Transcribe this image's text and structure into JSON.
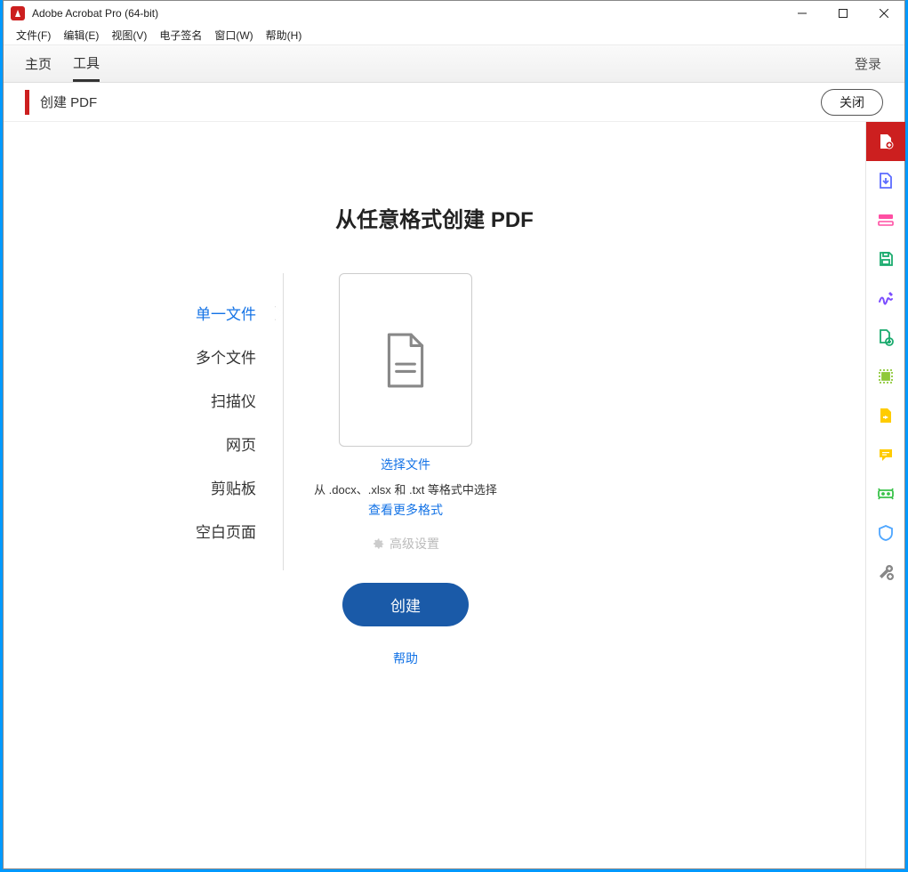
{
  "titlebar": {
    "title": "Adobe Acrobat Pro (64-bit)"
  },
  "menubar": {
    "file": "文件(F)",
    "edit": "编辑(E)",
    "view": "视图(V)",
    "esign": "电子签名",
    "window": "窗口(W)",
    "help": "帮助(H)"
  },
  "tabs": {
    "home": "主页",
    "tools": "工具",
    "signin": "登录"
  },
  "toolheader": {
    "name": "创建 PDF",
    "close": "关闭"
  },
  "headline": "从任意格式创建 PDF",
  "options": [
    "单一文件",
    "多个文件",
    "扫描仪",
    "网页",
    "剪贴板",
    "空白页面"
  ],
  "center": {
    "select_file": "选择文件",
    "formats_hint": "从 .docx、.xlsx 和 .txt 等格式中选择",
    "more_formats": "查看更多格式",
    "advanced": "高级设置",
    "create": "创建",
    "help": "帮助"
  },
  "side_icons": [
    "create-pdf-icon",
    "export-pdf-icon",
    "edit-pdf-icon",
    "save-icon",
    "sign-icon",
    "combine-icon",
    "organize-icon",
    "share-icon",
    "comment-icon",
    "redact-icon",
    "protect-icon",
    "more-tools-icon"
  ]
}
